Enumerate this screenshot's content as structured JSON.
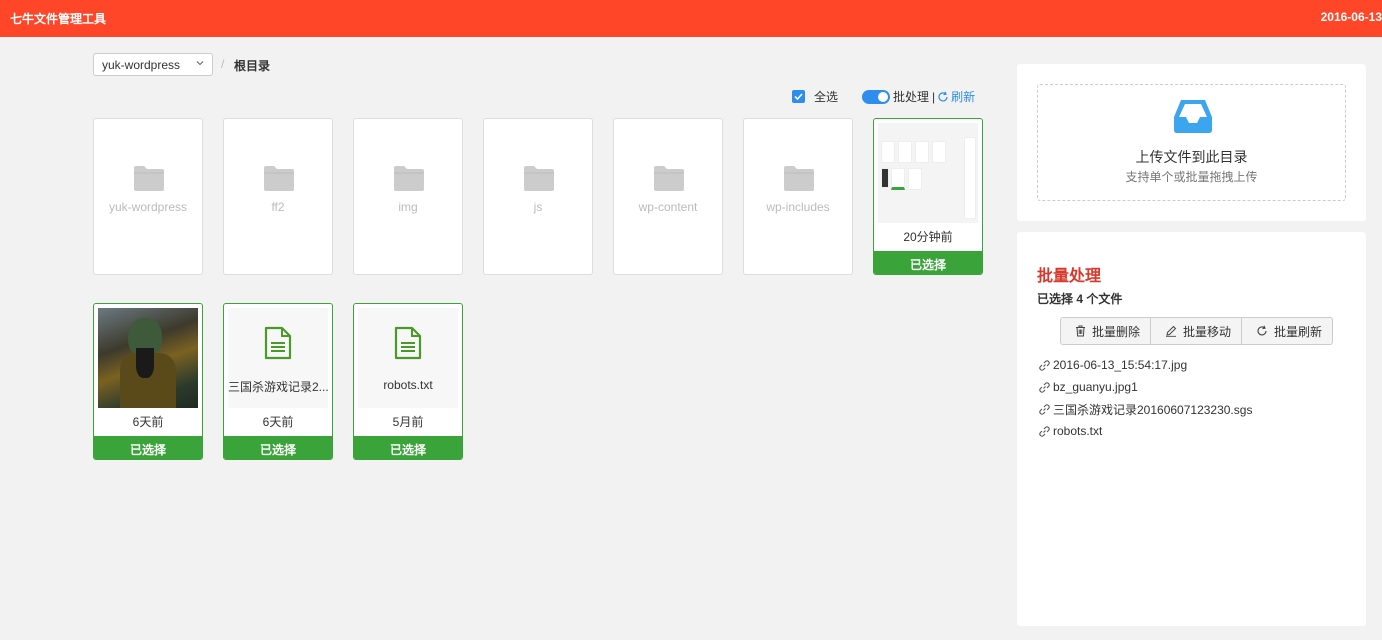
{
  "header": {
    "title": "七牛文件管理工具",
    "date": "2016-06-13"
  },
  "toolbar": {
    "bucket": "yuk-wordpress",
    "breadcrumb_sep": "/",
    "breadcrumb_root": "根目录",
    "select_all": "全选",
    "batch_toggle": "批处理",
    "divider": "|",
    "refresh": "刷新"
  },
  "folders": [
    {
      "name": "yuk-wordpress"
    },
    {
      "name": "ff2"
    },
    {
      "name": "img"
    },
    {
      "name": "js"
    },
    {
      "name": "wp-content"
    },
    {
      "name": "wp-includes"
    }
  ],
  "files": [
    {
      "name": "2016-06-13_15:54:17.jpg",
      "time": "20分钟前",
      "status": "已选择"
    },
    {
      "name": "bz_guanyu.jpg1",
      "time": "6天前",
      "status": "已选择"
    },
    {
      "name": "三国杀游戏记录2...",
      "time": "6天前",
      "status": "已选择"
    },
    {
      "name": "robots.txt",
      "time": "5月前",
      "status": "已选择"
    }
  ],
  "upload": {
    "title": "上传文件到此目录",
    "subtitle": "支持单个或批量拖拽上传"
  },
  "batch": {
    "title": "批量处理",
    "selected_prefix": "已选择 ",
    "selected_count": "4",
    "selected_suffix": " 个文件",
    "buttons": {
      "delete": "批量删除",
      "move": "批量移动",
      "refresh": "批量刷新"
    },
    "selected_files": [
      "2016-06-13_15:54:17.jpg",
      "bz_guanyu.jpg1",
      "三国杀游戏记录20160607123230.sgs",
      "robots.txt"
    ]
  },
  "colors": {
    "header_bg": "#ff4629",
    "accent_blue": "#2e8ded",
    "selected_green": "#3aa43a",
    "heading_red": "#d9382b"
  },
  "icons": [
    "folder-icon",
    "document-icon",
    "inbox-icon",
    "trash-icon",
    "pencil-icon",
    "refresh-icon",
    "link-icon",
    "chevron-down-icon",
    "checkmark-icon"
  ]
}
